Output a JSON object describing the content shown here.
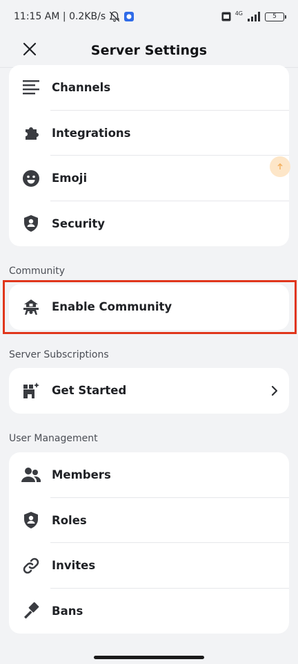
{
  "status_bar": {
    "time_speed": "11:15 AM | 0.2KB/s",
    "network_label": "4G",
    "battery_level": "5"
  },
  "header": {
    "title": "Server Settings"
  },
  "card_top": {
    "items": [
      {
        "label": "Channels",
        "icon": "channels-icon"
      },
      {
        "label": "Integrations",
        "icon": "integrations-icon"
      },
      {
        "label": "Emoji",
        "icon": "emoji-icon"
      },
      {
        "label": "Security",
        "icon": "security-icon"
      }
    ]
  },
  "community": {
    "section_label": "Community",
    "items": [
      {
        "label": "Enable Community",
        "icon": "community-icon"
      }
    ]
  },
  "subscriptions": {
    "section_label": "Server Subscriptions",
    "items": [
      {
        "label": "Get Started",
        "icon": "subscriptions-icon"
      }
    ]
  },
  "user_management": {
    "section_label": "User Management",
    "items": [
      {
        "label": "Members",
        "icon": "members-icon"
      },
      {
        "label": "Roles",
        "icon": "roles-icon"
      },
      {
        "label": "Invites",
        "icon": "invites-icon"
      },
      {
        "label": "Bans",
        "icon": "bans-icon"
      }
    ]
  },
  "colors": {
    "background": "#f2f3f5",
    "card": "#ffffff",
    "highlight": "#e0361b",
    "fab": "#fde6c8"
  }
}
